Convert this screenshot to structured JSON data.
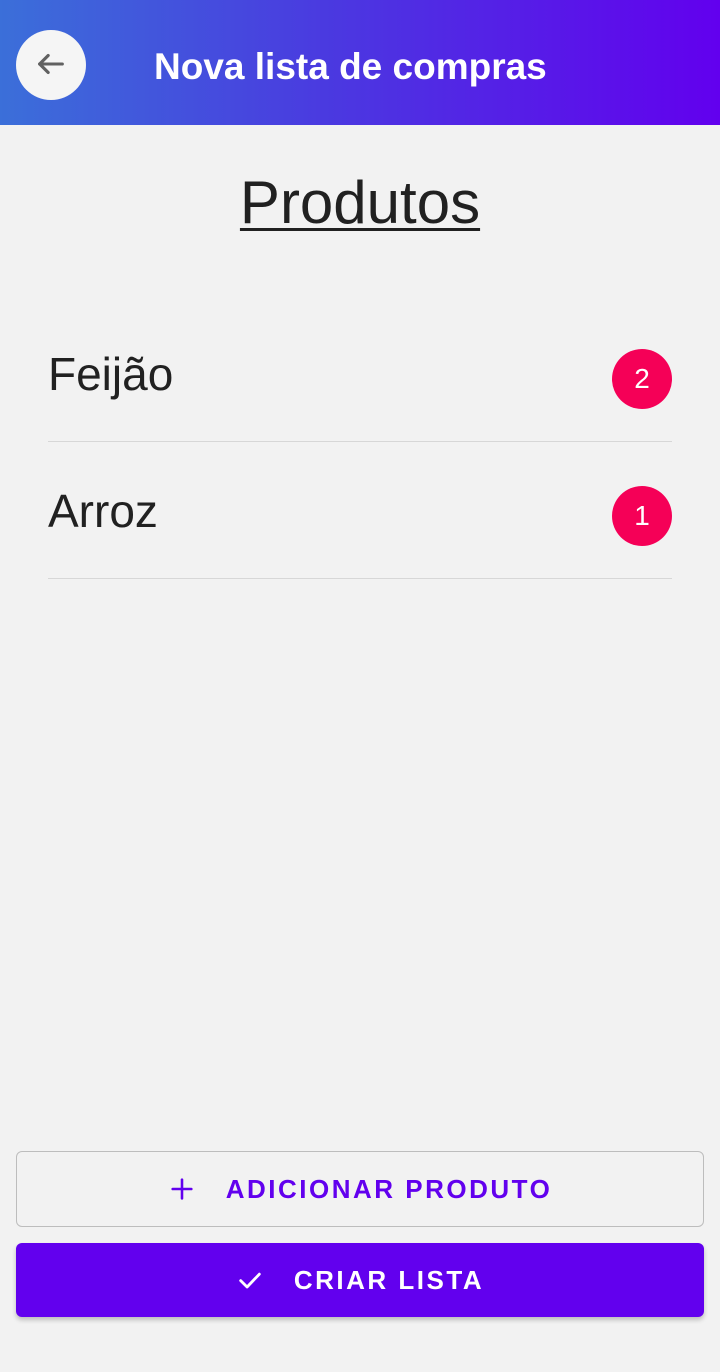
{
  "app_bar": {
    "title": "Nova lista de compras",
    "back_icon": "arrow-left-icon"
  },
  "section": {
    "title": "Produtos"
  },
  "products": [
    {
      "name": "Feijão",
      "quantity": "2"
    },
    {
      "name": "Arroz",
      "quantity": "1"
    }
  ],
  "actions": {
    "add_product_label": "ADICIONAR PRODUTO",
    "add_icon": "plus-icon",
    "create_list_label": "CRIAR LISTA",
    "create_icon": "check-icon"
  },
  "colors": {
    "primary": "#6200ee",
    "gradient_start": "#3b6fd9",
    "badge": "#f50057",
    "background": "#f2f2f2"
  }
}
